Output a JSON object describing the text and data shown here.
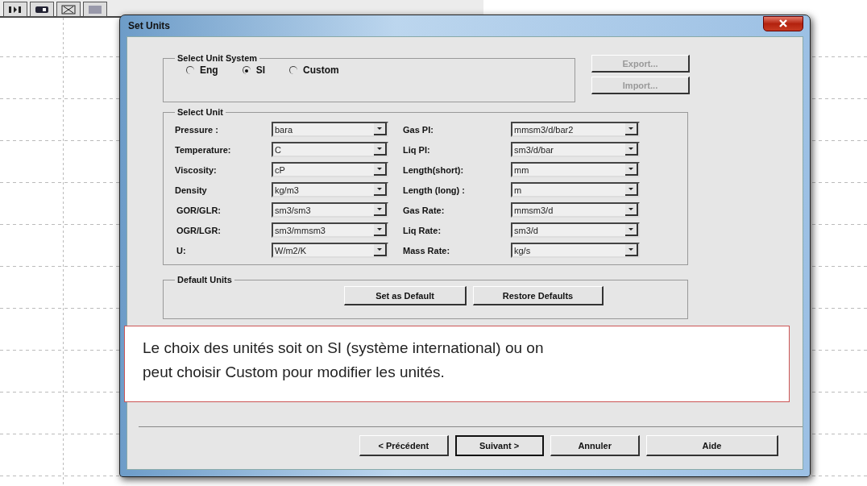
{
  "window": {
    "title": "Set Units"
  },
  "unit_system": {
    "title": "Select Unit System",
    "options": [
      {
        "label": "Eng",
        "selected": false
      },
      {
        "label": "SI",
        "selected": true
      },
      {
        "label": "Custom",
        "selected": false
      }
    ]
  },
  "side_buttons": [
    {
      "label": "Export...",
      "disabled": true
    },
    {
      "label": "Import...",
      "disabled": true
    }
  ],
  "select_unit": {
    "title": "Select Unit",
    "fields": [
      {
        "label": "Pressure :",
        "value": "bara"
      },
      {
        "label": "Gas PI:",
        "value": "mmsm3/d/bar2"
      },
      {
        "label": "Temperature:",
        "value": "C"
      },
      {
        "label": "Liq PI:",
        "value": "sm3/d/bar"
      },
      {
        "label": "Viscosity:",
        "value": "cP"
      },
      {
        "label": "Length(short):",
        "value": "mm"
      },
      {
        "label": "Density",
        "value": "kg/m3"
      },
      {
        "label": "Length (long) :",
        "value": "m"
      },
      {
        "label": "GOR/GLR:",
        "value": "sm3/sm3"
      },
      {
        "label": "Gas Rate:",
        "value": "mmsm3/d"
      },
      {
        "label": "OGR/LGR:",
        "value": "sm3/mmsm3"
      },
      {
        "label": "Liq Rate:",
        "value": "sm3/d"
      },
      {
        "label": "U:",
        "value": "W/m2/K"
      },
      {
        "label": "Mass Rate:",
        "value": "kg/s"
      }
    ]
  },
  "default_units": {
    "title": "Default Units",
    "buttons": [
      "Set as Default",
      "Restore Defaults"
    ]
  },
  "note": "Le choix des unités soit on SI (système international) ou on peut choisir Custom pour modifier les unités.",
  "nav_buttons": [
    {
      "label": "< Précédent",
      "default": false
    },
    {
      "label": "Suivant >",
      "default": true
    },
    {
      "label": "Annuler",
      "default": false
    },
    {
      "label": "Aide",
      "default": false
    }
  ]
}
